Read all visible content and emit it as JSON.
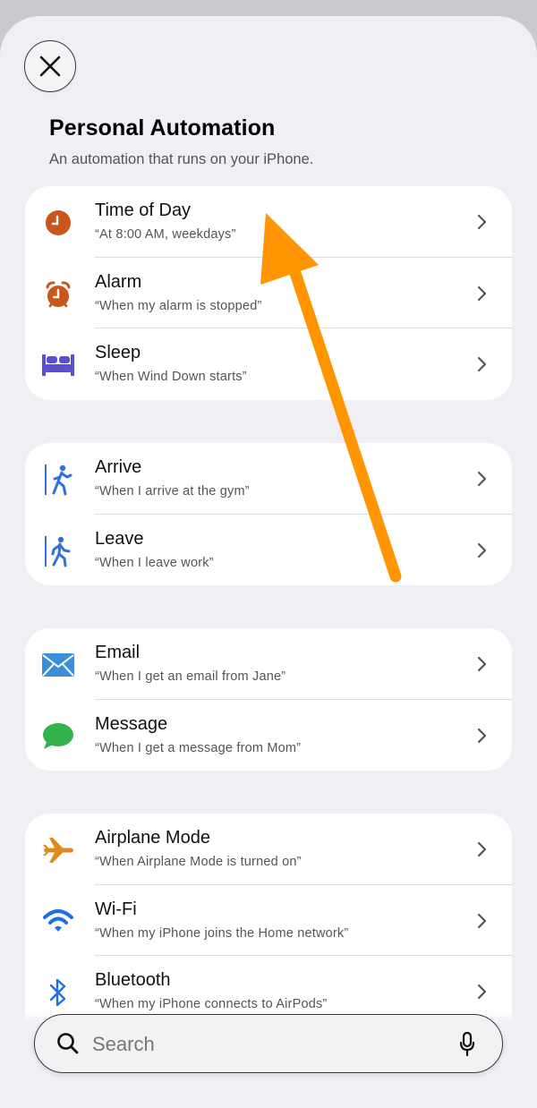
{
  "header": {
    "title": "Personal Automation",
    "subtitle": "An automation that runs on your iPhone."
  },
  "groups": [
    {
      "items": [
        {
          "label": "Time of Day",
          "desc": "“At 8:00 AM, weekdays”",
          "icon": "clock-icon"
        },
        {
          "label": "Alarm",
          "desc": "“When my alarm is stopped”",
          "icon": "alarm-icon"
        },
        {
          "label": "Sleep",
          "desc": "“When Wind Down starts”",
          "icon": "bed-icon"
        }
      ]
    },
    {
      "items": [
        {
          "label": "Arrive",
          "desc": "“When I arrive at the gym”",
          "icon": "arrive-icon"
        },
        {
          "label": "Leave",
          "desc": "“When I leave work”",
          "icon": "leave-icon"
        }
      ]
    },
    {
      "items": [
        {
          "label": "Email",
          "desc": "“When I get an email from Jane”",
          "icon": "mail-icon"
        },
        {
          "label": "Message",
          "desc": "“When I get a message from Mom”",
          "icon": "message-icon"
        }
      ]
    },
    {
      "items": [
        {
          "label": "Airplane Mode",
          "desc": "“When Airplane Mode is turned on”",
          "icon": "airplane-icon"
        },
        {
          "label": "Wi-Fi",
          "desc": "“When my iPhone joins the Home network”",
          "icon": "wifi-icon"
        },
        {
          "label": "Bluetooth",
          "desc": "“When my iPhone connects to AirPods”",
          "icon": "bluetooth-icon"
        }
      ]
    }
  ],
  "search": {
    "placeholder": "Search"
  },
  "colors": {
    "clock": "#c9561a",
    "bed": "#5a4fcf",
    "location": "#2f6fe0",
    "mail": "#3a8fd8",
    "message": "#34b34a",
    "airplane": "#e08a1e",
    "wifi": "#1f6fe8",
    "bluetooth": "#1f6fe8",
    "arrow_annotation": "#ff9500"
  }
}
